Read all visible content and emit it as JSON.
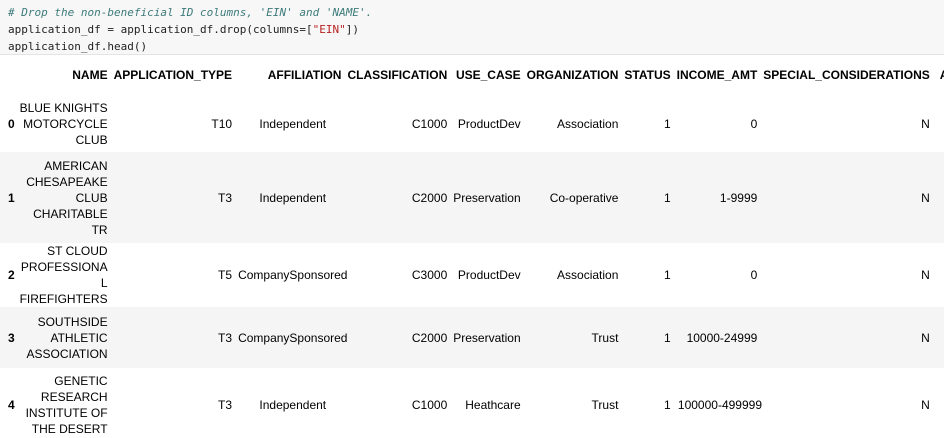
{
  "code": {
    "comment": "# Drop the non-beneficial ID columns, 'EIN' and 'NAME'.",
    "line2_a": "application_df = application_df.drop(columns=[",
    "line2_str": "\"EIN\"",
    "line2_b": "])",
    "line3": "application_df.head()"
  },
  "table": {
    "columns": [
      "",
      "NAME",
      "APPLICATION_TYPE",
      "AFFILIATION",
      "CLASSIFICATION",
      "USE_CASE",
      "ORGANIZATION",
      "STATUS",
      "INCOME_AMT",
      "SPECIAL_CONSIDERATIONS",
      "A"
    ],
    "rows": [
      {
        "index": "0",
        "name": "BLUE KNIGHTS MOTORCYCLE CLUB",
        "application_type": "T10",
        "affiliation": "Independent",
        "classification": "C1000",
        "use_case": "ProductDev",
        "organization": "Association",
        "status": "1",
        "income_amt": "0",
        "special_considerations": "N"
      },
      {
        "index": "1",
        "name": "AMERICAN CHESAPEAKE CLUB CHARITABLE TR",
        "application_type": "T3",
        "affiliation": "Independent",
        "classification": "C2000",
        "use_case": "Preservation",
        "organization": "Co-operative",
        "status": "1",
        "income_amt": "1-9999",
        "special_considerations": "N"
      },
      {
        "index": "2",
        "name": "ST CLOUD PROFESSIONAL FIREFIGHTERS",
        "application_type": "T5",
        "affiliation": "CompanySponsored",
        "classification": "C3000",
        "use_case": "ProductDev",
        "organization": "Association",
        "status": "1",
        "income_amt": "0",
        "special_considerations": "N"
      },
      {
        "index": "3",
        "name": "SOUTHSIDE ATHLETIC ASSOCIATION",
        "application_type": "T3",
        "affiliation": "CompanySponsored",
        "classification": "C2000",
        "use_case": "Preservation",
        "organization": "Trust",
        "status": "1",
        "income_amt": "10000-24999",
        "special_considerations": "N"
      },
      {
        "index": "4",
        "name": "GENETIC RESEARCH INSTITUTE OF THE DESERT",
        "application_type": "T3",
        "affiliation": "Independent",
        "classification": "C1000",
        "use_case": "Heathcare",
        "organization": "Trust",
        "status": "1",
        "income_amt": "100000-499999",
        "special_considerations": "N"
      }
    ]
  }
}
